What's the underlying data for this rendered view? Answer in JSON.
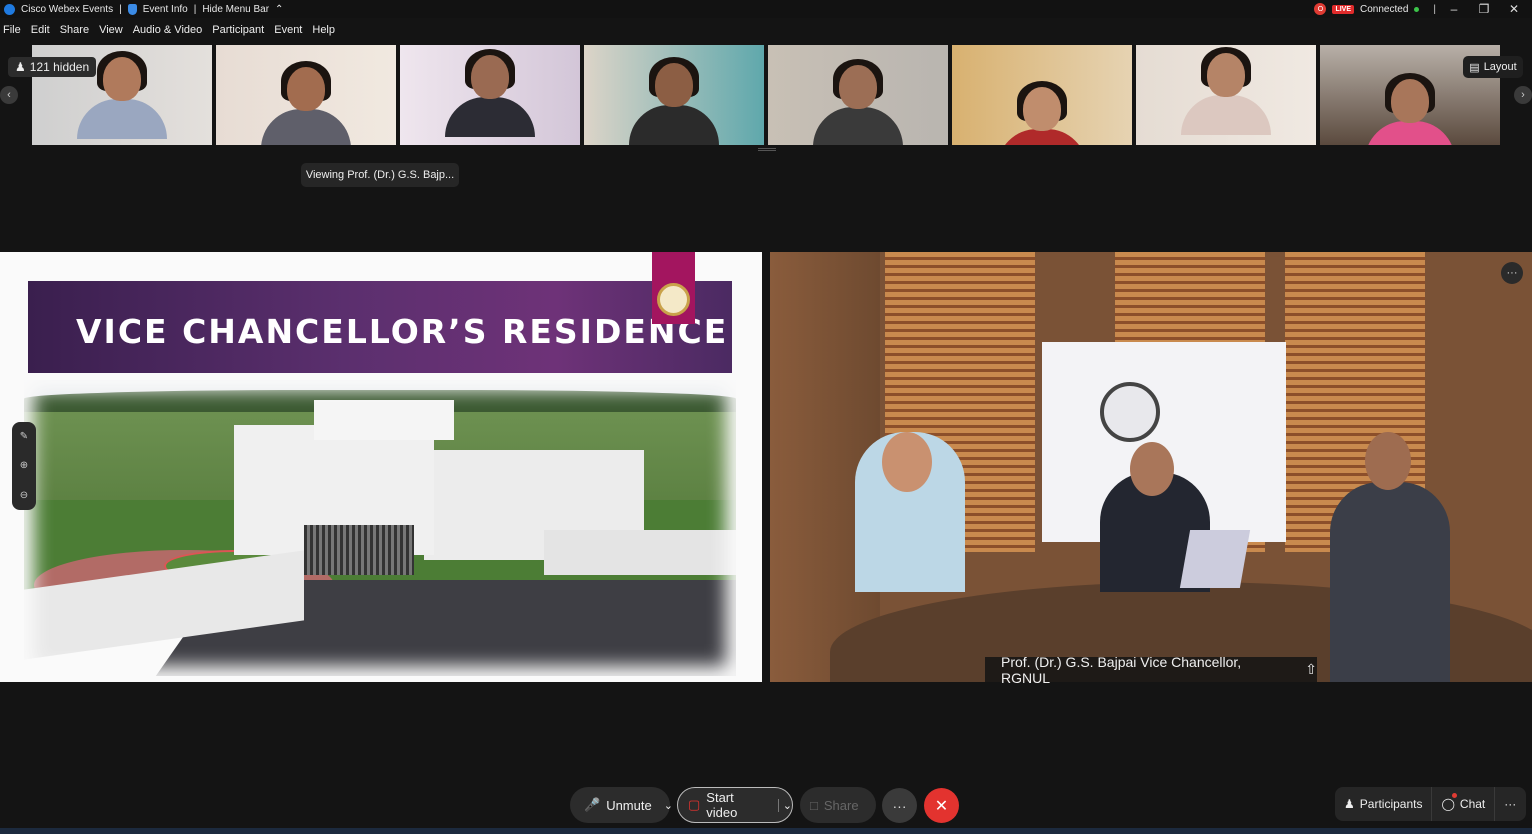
{
  "titlebar": {
    "app_name": "Cisco Webex Events",
    "sep": "|",
    "event_info": "Event Info",
    "hide_menu_bar": "Hide Menu Bar",
    "rec_label": "O",
    "live_label": "LIVE",
    "status": "Connected",
    "bar": "|"
  },
  "menu": [
    "File",
    "Edit",
    "Share",
    "View",
    "Audio & Video",
    "Participant",
    "Event",
    "Help"
  ],
  "strip": {
    "hidden_count": "121 hidden",
    "layout_label": "Layout",
    "prev_arrow": "‹",
    "next_arrow": "›"
  },
  "viewing_label": "Viewing Prof. (Dr.) G.S. Bajp...",
  "slide": {
    "title": "VICE CHANCELLOR’S RESIDENCE"
  },
  "video": {
    "presenter_name": "Prof. (Dr.) G.S. Bajpai Vice Chancellor, RGNUL",
    "more": "···"
  },
  "controls": {
    "unmute": "Unmute",
    "start_video": "Start video",
    "share": "Share",
    "more": "···",
    "leave": "✕",
    "caret": "⌄"
  },
  "panel": {
    "participants": "Participants",
    "chat": "Chat",
    "more": "···"
  },
  "colors": {
    "accent_red": "#e3332f",
    "banner_purple": "#5b2f6e",
    "logo_magenta": "#a3155f"
  }
}
